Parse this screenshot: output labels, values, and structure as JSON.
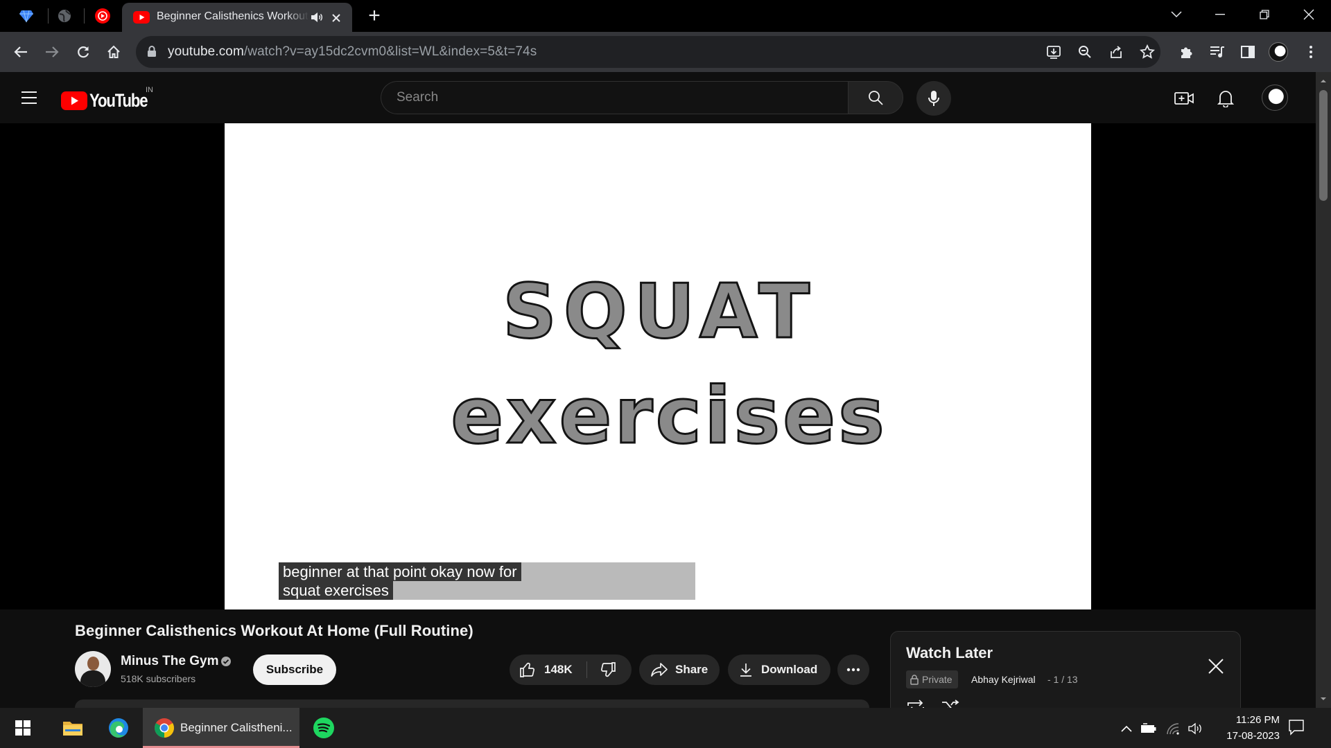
{
  "browser": {
    "active_tab_title": "Beginner Calisthenics Workout At Home (Full Routine)",
    "url_host": "youtube.com",
    "url_path": "/watch?v=ay15dc2cvm0&list=WL&index=5&t=74s"
  },
  "youtube": {
    "logo_text": "YouTube",
    "country_code": "IN",
    "search_placeholder": "Search"
  },
  "video": {
    "frame_line1": "SQUAT",
    "frame_line2": "exercises",
    "caption_line1": "beginner at that point okay now for",
    "caption_line2": "squat exercises",
    "title": "Beginner Calisthenics Workout At Home (Full Routine)",
    "channel_name": "Minus The Gym",
    "subscribers": "518K subscribers",
    "subscribe_label": "Subscribe",
    "likes": "148K",
    "share_label": "Share",
    "download_label": "Download"
  },
  "playlist": {
    "title": "Watch Later",
    "privacy": "Private",
    "owner": "Abhay Kejriwal",
    "position": "- 1 / 13"
  },
  "taskbar": {
    "chrome_label": "Beginner Calistheni...",
    "time": "11:26 PM",
    "date": "17-08-2023"
  },
  "colors": {
    "youtube_red": "#ff0000",
    "page_bg": "#0f0f0f",
    "chrome_toolbar": "#35363a",
    "spotify_green": "#1ed760"
  }
}
